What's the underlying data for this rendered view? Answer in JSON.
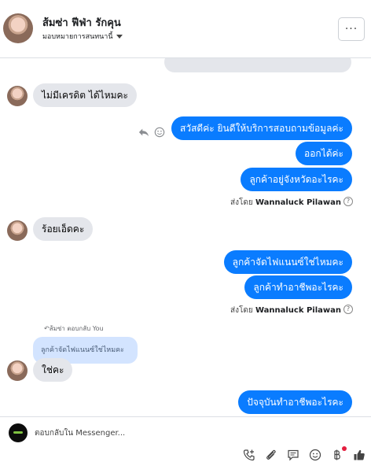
{
  "header": {
    "contact_name": "ส้มซ่า ฟีฟ่า รักคุน",
    "assign_label": "มอบหมายการสนทนานี้",
    "more_label": "···"
  },
  "messages": {
    "m1": "ไม่มีเครดิต ได้ไหมคะ",
    "m2": "สวัสดีค่ะ  ยินดีให้บริการสอบถามข้อมูลค่ะ",
    "m3": "ออกได้ค่ะ",
    "m4": "ลูกค้าอยู่จังหวัดอะไรคะ",
    "m5": "ร้อยเอ็ดคะ",
    "m6": "ลูกค้าจัดไฟแนนซ์ใช่ไหมคะ",
    "m7": "ลูกค้าทำอาชีพอะไรคะ",
    "m8": "ใช่คะ",
    "m9": "ปัจจุบันทำอาชีพอะไรคะ"
  },
  "sent_by": {
    "prefix": "ส่งโดย",
    "name": "Wannaluck Pilawan",
    "info_label": "?"
  },
  "reply": {
    "context": "↶ส้มซ่า ตอบกลับ You",
    "quote": "ลูกค้าจัดไฟแนนซ์ใช่ไหมคะ"
  },
  "composer": {
    "placeholder": "ตอบกลับใน Messenger..."
  },
  "colors": {
    "outgoing": "#0a7cff",
    "incoming": "#e4e6eb",
    "quote": "#d3e4ff",
    "notification_dot": "#e41e3f"
  },
  "icons": {
    "reply": "reply-icon",
    "emoji_react": "smiley-icon",
    "call": "phone-plus-icon",
    "attach": "paperclip-icon",
    "saved_replies": "chat-bubble-icon",
    "emoji": "smiley-icon",
    "payment": "baht-icon",
    "like": "thumbs-up-icon"
  }
}
